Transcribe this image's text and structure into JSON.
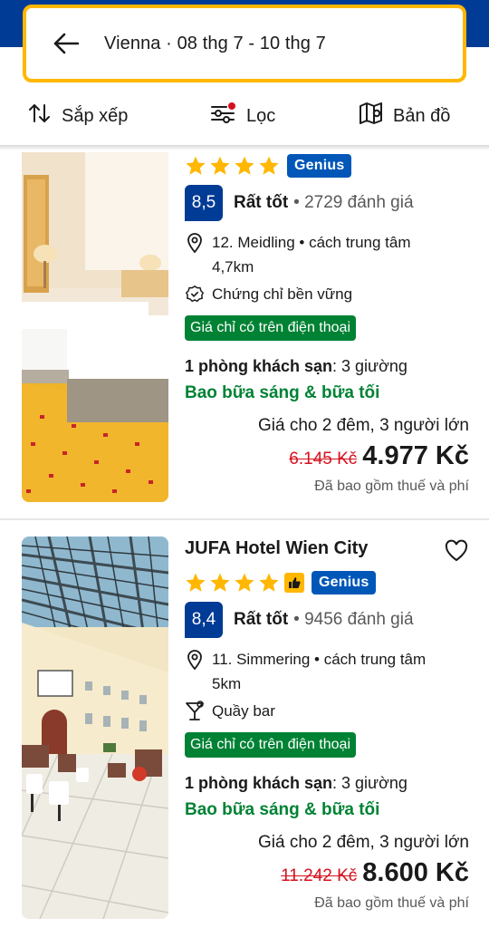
{
  "header": {
    "search_summary": "Vienna · 08 thg 7 - 10 thg 7"
  },
  "toolbar": {
    "sort_label": "Sắp xếp",
    "filter_label": "Lọc",
    "map_label": "Bản đồ"
  },
  "hotels": [
    {
      "stars": 4,
      "genius_label": "Genius",
      "score": "8,5",
      "rating_word": "Rất tốt",
      "rating_count": "• 2729 đánh giá",
      "location": "12. Meidling • cách trung tâm 4,7km",
      "extra": "Chứng chỉ bền vững",
      "mobile_badge": "Giá chỉ có trên điện thoại",
      "room_bold": "1 phòng khách sạn",
      "room_rest": ": 3 giường",
      "meal": "Bao bữa sáng & bữa tối",
      "price_for": "Giá cho 2 đêm, 3 người lớn",
      "old_price": "6.145 Kč",
      "new_price": "4.977 Kč",
      "taxes": "Đã bao gồm thuế và phí"
    },
    {
      "name": "JUFA Hotel Wien City",
      "stars": 4,
      "genius_label": "Genius",
      "score": "8,4",
      "rating_word": "Rất tốt",
      "rating_count": "• 9456 đánh giá",
      "location": "11. Simmering • cách trung tâm 5km",
      "extra": "Quầy bar",
      "mobile_badge": "Giá chỉ có trên điện thoại",
      "room_bold": "1 phòng khách sạn",
      "room_rest": ": 3 giường",
      "meal": "Bao bữa sáng & bữa tối",
      "price_for": "Giá cho 2 đêm, 3 người lớn",
      "old_price": "11.242 Kč",
      "new_price": "8.600 Kč",
      "taxes": "Đã bao gồm thuế và phí"
    }
  ],
  "colors": {
    "brand_blue": "#003b95",
    "search_border": "#ffb700",
    "genius_blue": "#0057b8",
    "green": "#008234",
    "strike_red": "#d4111e",
    "star_yellow": "#ffb700"
  }
}
